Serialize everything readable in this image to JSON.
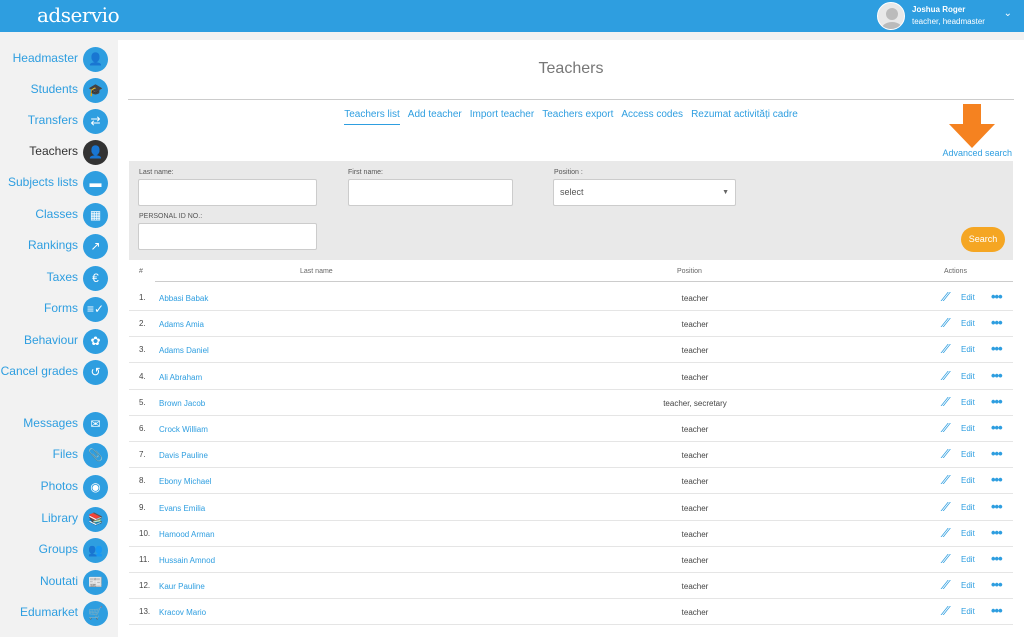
{
  "app": {
    "logo": "adservio"
  },
  "user": {
    "name": "Joshua Roger",
    "role": "teacher, headmaster"
  },
  "sidebar": {
    "items": [
      {
        "label": "Headmaster",
        "icon": "👤",
        "active": false
      },
      {
        "label": "Students",
        "icon": "🎓",
        "active": false
      },
      {
        "label": "Transfers",
        "icon": "⇄",
        "active": false
      },
      {
        "label": "Teachers",
        "icon": "👤",
        "active": true
      },
      {
        "label": "Subjects lists",
        "icon": "▬",
        "active": false
      },
      {
        "label": "Classes",
        "icon": "▦",
        "active": false
      },
      {
        "label": "Rankings",
        "icon": "↗",
        "active": false
      },
      {
        "label": "Taxes",
        "icon": "€",
        "active": false
      },
      {
        "label": "Forms",
        "icon": "≡✓",
        "active": false
      },
      {
        "label": "Behaviour",
        "icon": "✿",
        "active": false
      },
      {
        "label": "Cancel grades",
        "icon": "↺",
        "active": false
      },
      {
        "label": "Messages",
        "icon": "✉",
        "active": false
      },
      {
        "label": "Files",
        "icon": "📎",
        "active": false
      },
      {
        "label": "Photos",
        "icon": "◉",
        "active": false
      },
      {
        "label": "Library",
        "icon": "📚",
        "active": false
      },
      {
        "label": "Groups",
        "icon": "👥",
        "active": false
      },
      {
        "label": "Noutati",
        "icon": "📰",
        "active": false
      },
      {
        "label": "Edumarket",
        "icon": "🛒",
        "active": false
      }
    ]
  },
  "page": {
    "title": "Teachers",
    "tabs": [
      {
        "label": "Teachers list",
        "active": true
      },
      {
        "label": "Add teacher",
        "active": false
      },
      {
        "label": "Import teacher",
        "active": false
      },
      {
        "label": "Teachers export",
        "active": false
      },
      {
        "label": "Access codes",
        "active": false
      },
      {
        "label": "Rezumat activități cadre",
        "active": false
      }
    ],
    "advanced_search": "Advanced search"
  },
  "search": {
    "last_name_label": "Last name:",
    "last_name_value": "",
    "first_name_label": "First name:",
    "first_name_value": "",
    "position_label": "Position :",
    "position_value": "select",
    "personal_id_label": "PERSONAL ID NO.:",
    "personal_id_value": "",
    "button": "Search"
  },
  "table": {
    "headers": {
      "num": "#",
      "last_name": "Last name",
      "position": "Position",
      "actions": "Actions"
    },
    "edit_label": "Edit",
    "rows": [
      {
        "num": "1.",
        "name": "Abbasi Babak",
        "position": "teacher"
      },
      {
        "num": "2.",
        "name": "Adams Amia",
        "position": "teacher"
      },
      {
        "num": "3.",
        "name": "Adams Daniel",
        "position": "teacher"
      },
      {
        "num": "4.",
        "name": "Ali Abraham",
        "position": "teacher"
      },
      {
        "num": "5.",
        "name": "Brown Jacob",
        "position": "teacher, secretary"
      },
      {
        "num": "6.",
        "name": "Crock William",
        "position": "teacher"
      },
      {
        "num": "7.",
        "name": "Davis Pauline",
        "position": "teacher"
      },
      {
        "num": "8.",
        "name": "Ebony Michael",
        "position": "teacher"
      },
      {
        "num": "9.",
        "name": "Evans Emilia",
        "position": "teacher"
      },
      {
        "num": "10.",
        "name": "Hamood Arman",
        "position": "teacher"
      },
      {
        "num": "11.",
        "name": "Hussain Amnod",
        "position": "teacher"
      },
      {
        "num": "12.",
        "name": "Kaur Pauline",
        "position": "teacher"
      },
      {
        "num": "13.",
        "name": "Kracov Mario",
        "position": "teacher"
      }
    ]
  },
  "colors": {
    "brand": "#2e9ee0",
    "accent": "#f5a623",
    "arrow": "#f58220"
  }
}
